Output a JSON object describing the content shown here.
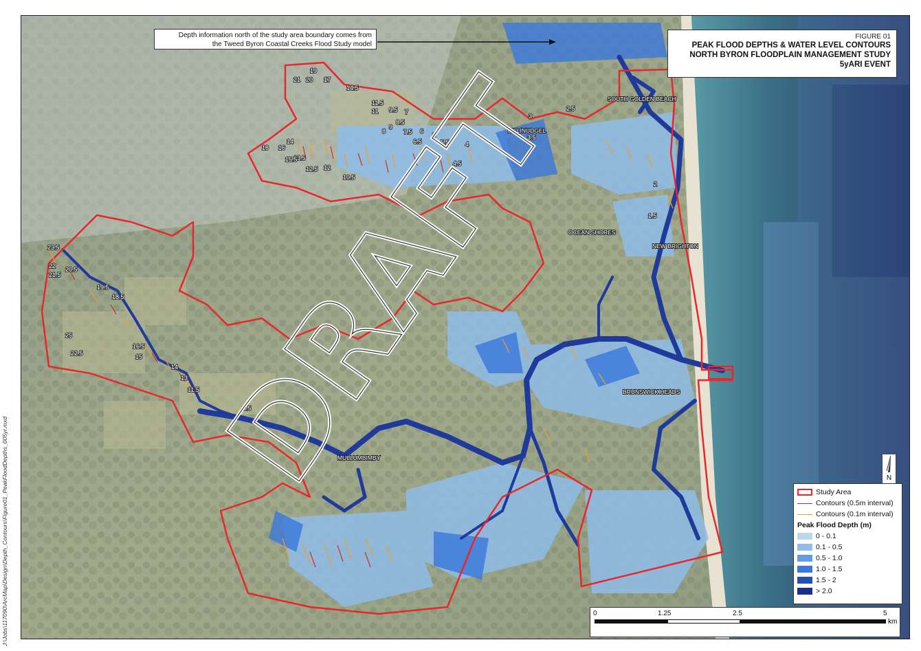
{
  "title": {
    "figure_no": "FIGURE 01",
    "line1": "PEAK FLOOD DEPTHS & WATER LEVEL CONTOURS",
    "line2": "NORTH BYRON FLOODPLAIN MANAGEMENT STUDY",
    "line3": "5yARI EVENT"
  },
  "callout": {
    "line1": "Depth information north of the study area boundary comes from",
    "line2": "the Tweed Byron Coastal Creeks Flood Study model"
  },
  "side_path": "J:\\Jobs\\117090\\ArcMap\\Design\\Depth_Contours\\Figure01_PeakFloodDepths_005yr.mxd",
  "watermark": "DRAFT",
  "places": [
    {
      "name": "SOUTH GOLDEN BEACH"
    },
    {
      "name": "BILLINUDGEL"
    },
    {
      "name": "OCEAN SHORES"
    },
    {
      "name": "NEW BRIGHTON"
    },
    {
      "name": "BRUNSWICK HEADS"
    },
    {
      "name": "MULLUMBIMBY"
    }
  ],
  "contour_labels": [
    "19",
    "21",
    "20",
    "17",
    "14.5",
    "11.5",
    "11",
    "9.5",
    "7",
    "8.5",
    "9",
    "7.5",
    "8",
    "6.5",
    "6",
    "5",
    "5.5",
    "4",
    "4.5",
    "18",
    "16",
    "14",
    "13.5",
    "15.5",
    "12.5",
    "12",
    "10.5",
    "3.5",
    "3",
    "2.5",
    "2",
    "1.5",
    "23.5",
    "22",
    "20.5",
    "21.5",
    "19.5",
    "18.5",
    "25",
    "22.5",
    "16.5",
    "15",
    "14",
    "13",
    "11.5",
    "8.5"
  ],
  "legend": {
    "study_area": "Study Area",
    "contour_05": "Contours (0.5m interval)",
    "contour_01": "Contours (0.1m interval)",
    "depth_title": "Peak Flood Depth (m)",
    "classes": [
      {
        "label": "0 - 0.1",
        "color": "#bcd8ec"
      },
      {
        "label": "0.1 - 0.5",
        "color": "#8fbce8"
      },
      {
        "label": "0.5 - 1.0",
        "color": "#5f9ee3"
      },
      {
        "label": "1.0 - 1.5",
        "color": "#3a78db"
      },
      {
        "label": "1.5 - 2",
        "color": "#2350b5"
      },
      {
        "label": "> 2.0",
        "color": "#1a2f8f"
      }
    ],
    "colors": {
      "study_area": "#e8262b",
      "contour_05": "#d62a1e",
      "contour_01": "#f0a020"
    }
  },
  "north": {
    "label": "N"
  },
  "scale": {
    "ticks": [
      "0",
      "1.25",
      "2.5",
      "5"
    ],
    "unit": "km"
  }
}
